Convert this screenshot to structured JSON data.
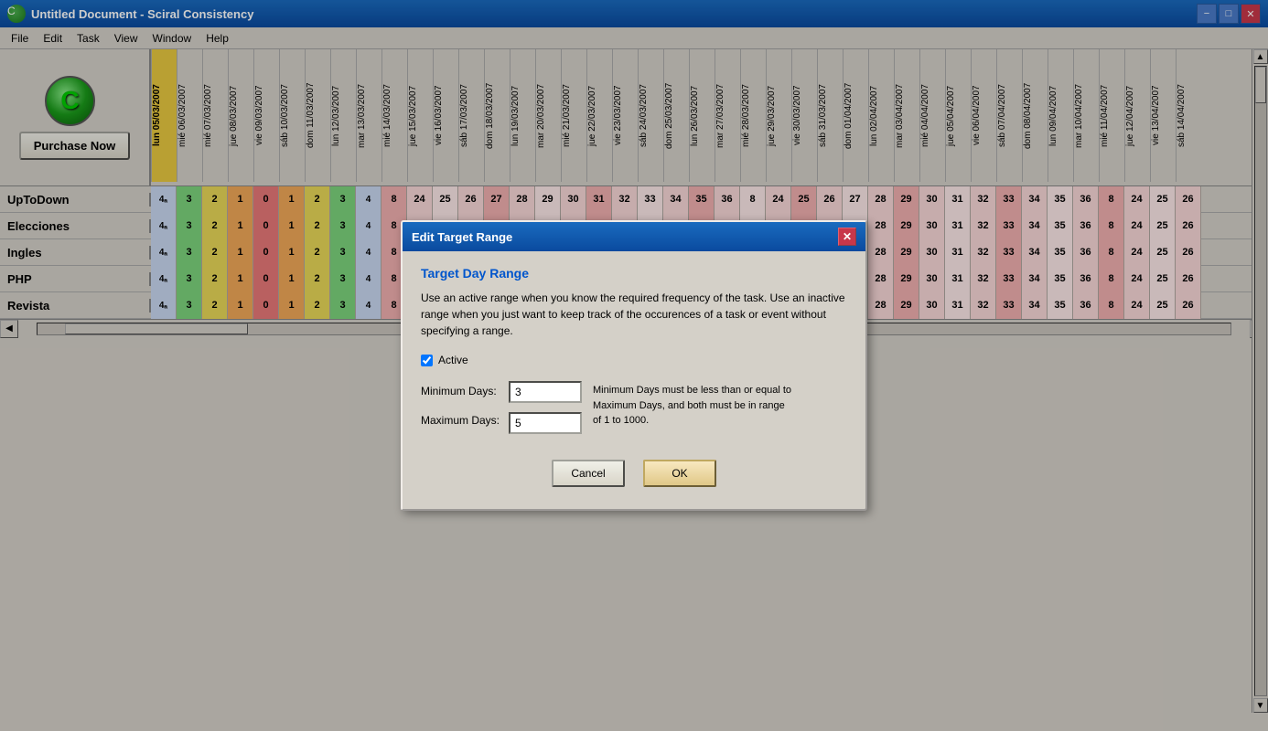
{
  "titleBar": {
    "icon": "C",
    "title": "Untitled Document - Sciral Consistency",
    "minimizeLabel": "−",
    "maximizeLabel": "□",
    "closeLabel": "✕"
  },
  "menuBar": {
    "items": [
      "File",
      "Edit",
      "Task",
      "View",
      "Window",
      "Help"
    ]
  },
  "toolbar": {
    "purchaseLabel": "Purchase Now"
  },
  "dates": [
    "lun 05/03/2007",
    "mié 06/03/2007",
    "mié 07/03/2007",
    "jue 08/03/2007",
    "vie 09/03/2007",
    "sáb 10/03/2007",
    "dom 11/03/2007",
    "lun 12/03/2007",
    "mar 13/03/2007",
    "mié 14/03/2007",
    "jue 15/03/2007",
    "vie 16/03/2007",
    "sáb 17/03/2007",
    "dom 18/03/2007",
    "lun 19/03/2007",
    "mar 20/03/2007",
    "mié 21/03/2007",
    "jue 22/03/2007",
    "vie 23/03/2007",
    "sáb 24/03/2007",
    "dom 25/03/2007",
    "lun 26/03/2007",
    "mar 27/03/2007",
    "mié 28/03/2007",
    "jue 29/03/2007",
    "vie 30/03/2007",
    "sáb 31/03/2007",
    "dom 01/04/2007",
    "lun 02/04/2007",
    "mar 03/04/2007",
    "mié 04/04/2007",
    "jue 05/04/2007",
    "vie 06/04/2007",
    "sáb 07/04/2007",
    "dom 08/04/2007",
    "lun 09/04/2007",
    "mar 10/04/2007",
    "mié 11/04/2007",
    "jue 12/04/2007",
    "vie 13/04/2007",
    "sáb 14/04/2007"
  ],
  "tasks": [
    {
      "name": "UpToDown"
    },
    {
      "name": "Elecciones"
    },
    {
      "name": "Ingles"
    },
    {
      "name": "PHP"
    },
    {
      "name": "Revista"
    }
  ],
  "taskCells": {
    "prefix": [
      "4ₐ",
      "3",
      "2",
      "1",
      "0",
      "1",
      "2",
      "3",
      "4"
    ],
    "suffix_values": [
      "8",
      "24",
      "25",
      "26",
      "27",
      "28",
      "29",
      "30",
      "31",
      "32",
      "33",
      "34",
      "35",
      "36"
    ]
  },
  "modal": {
    "title": "Edit Target Range",
    "sectionTitle": "Target Day Range",
    "description": "Use an active range when you know the required frequency of the task. Use an inactive range when you just want to keep track of the occurences of a task or event without specifying a range.",
    "activeLabel": "Active",
    "activeChecked": true,
    "minDaysLabel": "Minimum Days:",
    "minDaysValue": "3",
    "maxDaysLabel": "Maximum Days:",
    "maxDaysValue": "5",
    "hintText": "Minimum Days must be less than or equal to Maximum Days, and both must be in range of 1 to 1000.",
    "cancelLabel": "Cancel",
    "okLabel": "OK"
  }
}
